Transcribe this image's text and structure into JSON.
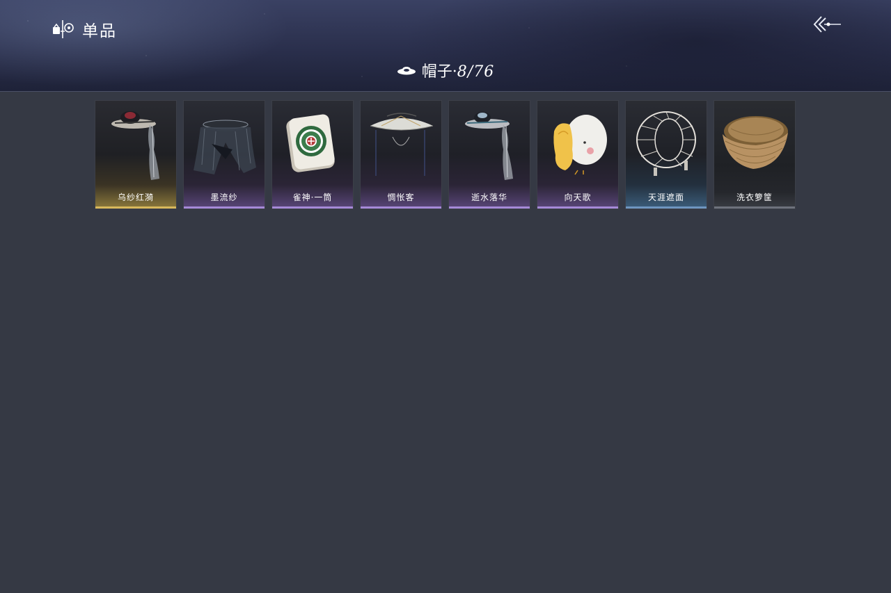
{
  "header": {
    "section_label": "单品",
    "section_icon": "wardrobe-icon",
    "back_icon": "back-arrow-icon",
    "category": {
      "icon": "hat-icon",
      "name": "帽子",
      "separator": "·",
      "count": "8/76"
    }
  },
  "items": [
    {
      "name": "乌纱红漪",
      "rarity_color": "#d8b85c",
      "icon": "veiled-hat-red-icon"
    },
    {
      "name": "墨流纱",
      "rarity_color": "#a68ad8",
      "icon": "black-veil-hat-icon"
    },
    {
      "name": "雀神·一筒",
      "rarity_color": "#a68ad8",
      "icon": "mahjong-tile-icon"
    },
    {
      "name": "惆怅客",
      "rarity_color": "#a68ad8",
      "icon": "bamboo-hat-icon"
    },
    {
      "name": "逝水落华",
      "rarity_color": "#a68ad8",
      "icon": "veiled-hat-blue-icon"
    },
    {
      "name": "向天歌",
      "rarity_color": "#a68ad8",
      "icon": "goose-hood-icon"
    },
    {
      "name": "天涯遮面",
      "rarity_color": "#6f96c0",
      "icon": "wire-frame-hat-icon"
    },
    {
      "name": "洗衣箩筐",
      "rarity_color": "#6e727c",
      "icon": "wicker-basket-icon"
    }
  ]
}
